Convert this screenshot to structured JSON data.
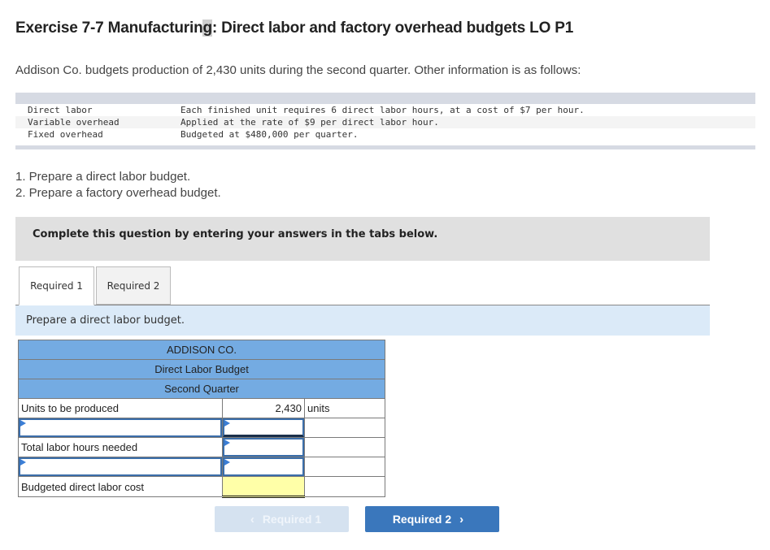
{
  "header": {
    "title_pre": "Exercise 7-7 Manufacturin",
    "title_hl": "g",
    "title_post": ": Direct labor and factory overhead budgets LO P1",
    "intro": "Addison Co. budgets production of 2,430 units during the second quarter. Other information is as follows:"
  },
  "info": {
    "rows": [
      {
        "label": "Direct labor",
        "value": "Each finished unit requires 6 direct labor hours, at a cost of $7 per hour."
      },
      {
        "label": "Variable overhead",
        "value": "Applied at the rate of $9 per direct labor hour."
      },
      {
        "label": "Fixed overhead",
        "value": "Budgeted at $480,000 per quarter."
      }
    ]
  },
  "tasks": [
    "1. Prepare a direct labor budget.",
    "2. Prepare a factory overhead budget."
  ],
  "banner": "Complete this question by entering your answers in the tabs below.",
  "tabs": [
    {
      "label": "Required 1",
      "active": true
    },
    {
      "label": "Required 2",
      "active": false
    }
  ],
  "prompt": "Prepare a direct labor budget.",
  "budget": {
    "company": "ADDISON CO.",
    "title": "Direct Labor Budget",
    "period": "Second Quarter",
    "rows": [
      {
        "label": "Units to be produced",
        "value": "2,430",
        "unit": "units"
      },
      {
        "label": "",
        "value": "",
        "unit": ""
      },
      {
        "label": "Total labor hours needed",
        "value": "",
        "unit": ""
      },
      {
        "label": "",
        "value": "",
        "unit": ""
      },
      {
        "label": "Budgeted direct labor cost",
        "value": "",
        "unit": ""
      }
    ]
  },
  "nav": {
    "prev_label": "Required 1",
    "next_label": "Required 2",
    "prev_icon": "‹",
    "next_icon": "›"
  },
  "colors": {
    "header_blue": "#74abe2",
    "prompt_bg": "#dbeaf8",
    "next_button": "#3a77bc",
    "prev_button_disabled": "#d5e2f0",
    "total_cell": "#ffffa8"
  }
}
